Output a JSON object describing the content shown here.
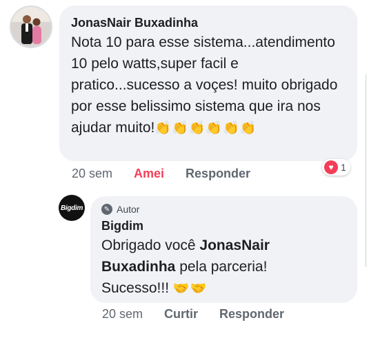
{
  "comment": {
    "author": "JonasNair Buxadinha",
    "text": "Nota 10 para esse sistema...atendimento 10 pelo watts,super facil e pratico...sucesso a voçes! muito obrigado por esse belissimo sistema que ira nos ajudar muito!",
    "emoji": "👏👏👏👏👏👏",
    "time": "20 sem",
    "reaction_label": "Amei",
    "reply_label": "Responder",
    "reaction_icon": "heart-icon",
    "reaction_count": "1"
  },
  "reply": {
    "avatar_text": "Bigdim",
    "author_badge": "Autor",
    "badge_icon": "pencil-icon",
    "author": "Bigdim",
    "text_1": "Obrigado você ",
    "text_mention": "JonasNair Buxadinha",
    "text_2": " pela parceria!",
    "text_3": "Sucesso!!! ",
    "emoji": "🤝🤝",
    "time": "20 sem",
    "like_label": "Curtir",
    "reply_label": "Responder"
  },
  "colors": {
    "bubble": "#f0f2f5",
    "love": "#f33e58",
    "secondary_text": "#606770"
  }
}
